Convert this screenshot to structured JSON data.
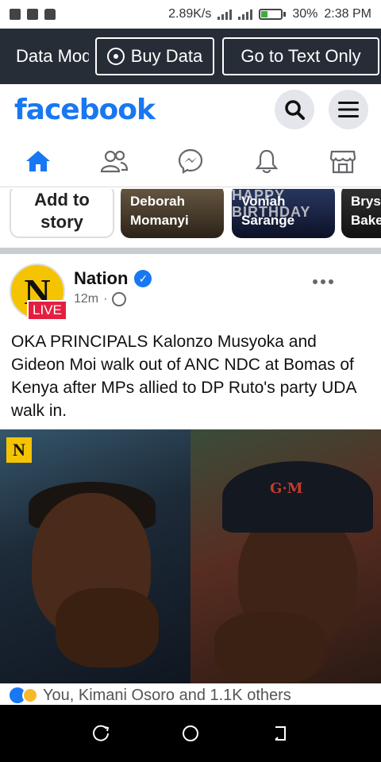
{
  "status_bar": {
    "speed": "2.89K/s",
    "battery": "30%",
    "time": "2:38 PM",
    "battery_level": 0.3
  },
  "data_banner": {
    "mode_text": "Data Mode",
    "buy_data_label": "Buy Data",
    "text_only_label": "Go to Text Only"
  },
  "header": {
    "logo": "facebook"
  },
  "nav_tabs": [
    "home",
    "friends",
    "messenger",
    "notifications",
    "marketplace"
  ],
  "stories": {
    "add_line1": "Add to",
    "add_line2": "story",
    "items": [
      {
        "name_line1": "Deborah",
        "name_line2": "Momanyi"
      },
      {
        "name_line1": "Voniah",
        "name_line2": "Sarange",
        "banner": "HAPPY BIRTHDAY"
      },
      {
        "name_line1": "Brys",
        "name_line2": "Bake"
      }
    ]
  },
  "post": {
    "author": "Nation",
    "avatar_letter": "N",
    "live_label": "LIVE",
    "time": "12m",
    "separator": "·",
    "text": "OKA PRINCIPALS Kalonzo Musyoka and Gideon Moi walk out of ANC NDC at Bomas of Kenya after MPs allied to DP Ruto's party UDA walk in.",
    "image_badge": "N",
    "cap_text": "G·M",
    "reactions_text": "You, Kimani Osoro and 1.1K others"
  },
  "colors": {
    "brand": "#1877f2",
    "banner_bg": "#262d36",
    "live": "#e41e3f"
  }
}
